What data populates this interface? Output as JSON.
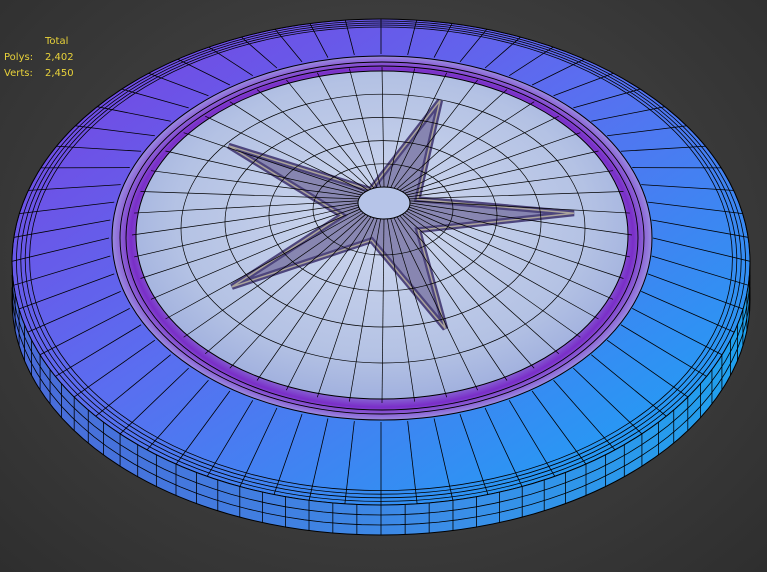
{
  "stats": {
    "header": "Total",
    "polys_label": "Polys:",
    "polys_value": "2,402",
    "verts_label": "Verts:",
    "verts_value": "2,450"
  },
  "colors": {
    "viewport_bg": "#3c3c3c",
    "stats_text": "#e8d23a",
    "rim_purple": "#7a3fe0",
    "rim_blue": "#1e9cf0",
    "center_pale": "#b9c6e6",
    "star_dark": "#4a3a7a",
    "wire": "#000000"
  },
  "icons": {
    "mesh": "frisbee-wireframe-mesh"
  }
}
